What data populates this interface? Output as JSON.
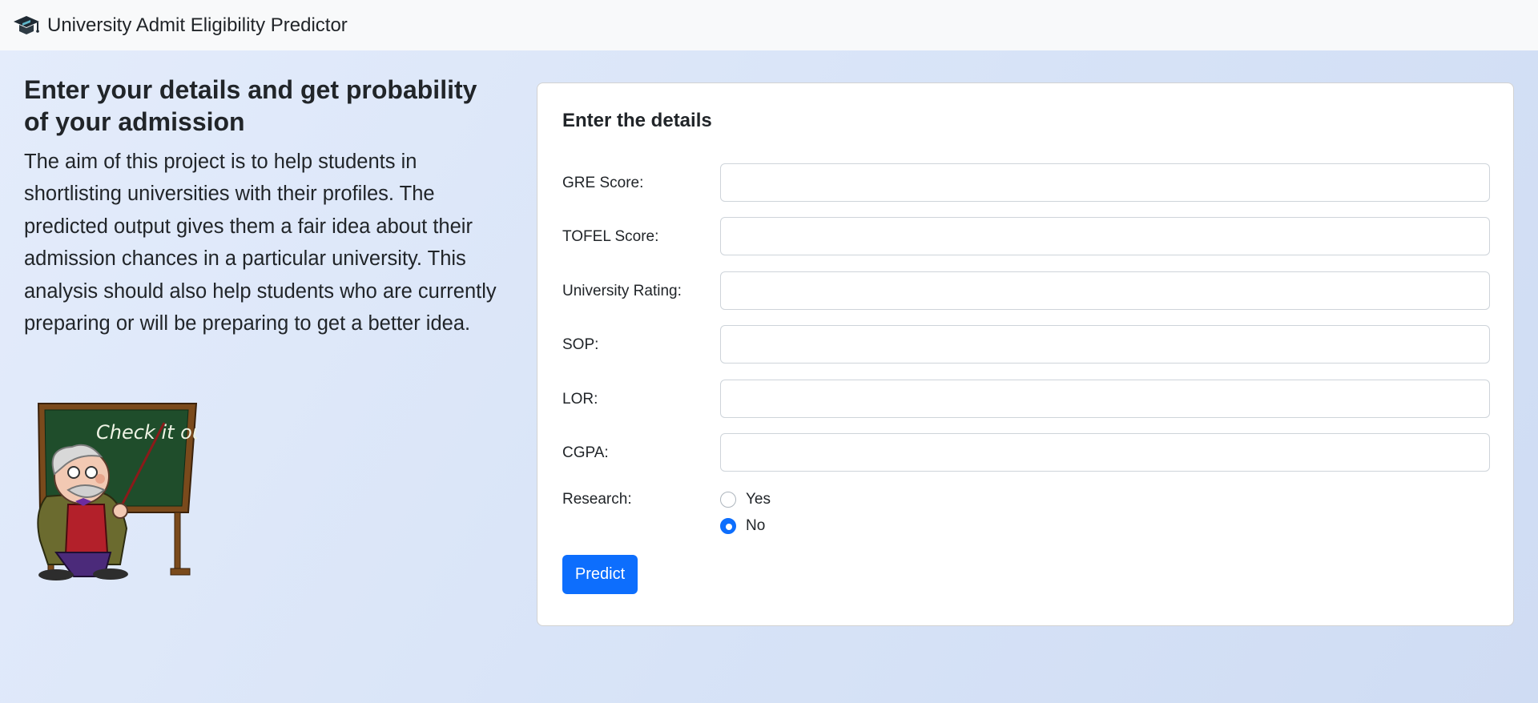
{
  "navbar": {
    "title": "University Admit Eligibility Predictor",
    "icon": "graduation-cap-icon"
  },
  "intro": {
    "heading": "Enter your details and get probability of your admission",
    "body": "The aim of this project is to help students in shortlisting universities with their profiles. The predicted output gives them a fair idea about their admission chances in a particular university. This analysis should also help students who are currently preparing or will be preparing to get a better idea.",
    "illustration": "teacher-at-chalkboard",
    "chalkboard_text": "Check it out"
  },
  "form": {
    "title": "Enter the details",
    "fields": [
      {
        "label": "GRE Score:",
        "value": ""
      },
      {
        "label": "TOFEL Score:",
        "value": ""
      },
      {
        "label": "University Rating:",
        "value": ""
      },
      {
        "label": "SOP:",
        "value": ""
      },
      {
        "label": "LOR:",
        "value": ""
      },
      {
        "label": "CGPA:",
        "value": ""
      }
    ],
    "research": {
      "label": "Research:",
      "options": [
        {
          "label": "Yes",
          "checked": false
        },
        {
          "label": "No",
          "checked": true
        }
      ]
    },
    "submit_label": "Predict"
  },
  "colors": {
    "accent": "#0d6efd",
    "navbar_bg": "#f8f9fa",
    "page_bg": "#dbe5f8"
  }
}
